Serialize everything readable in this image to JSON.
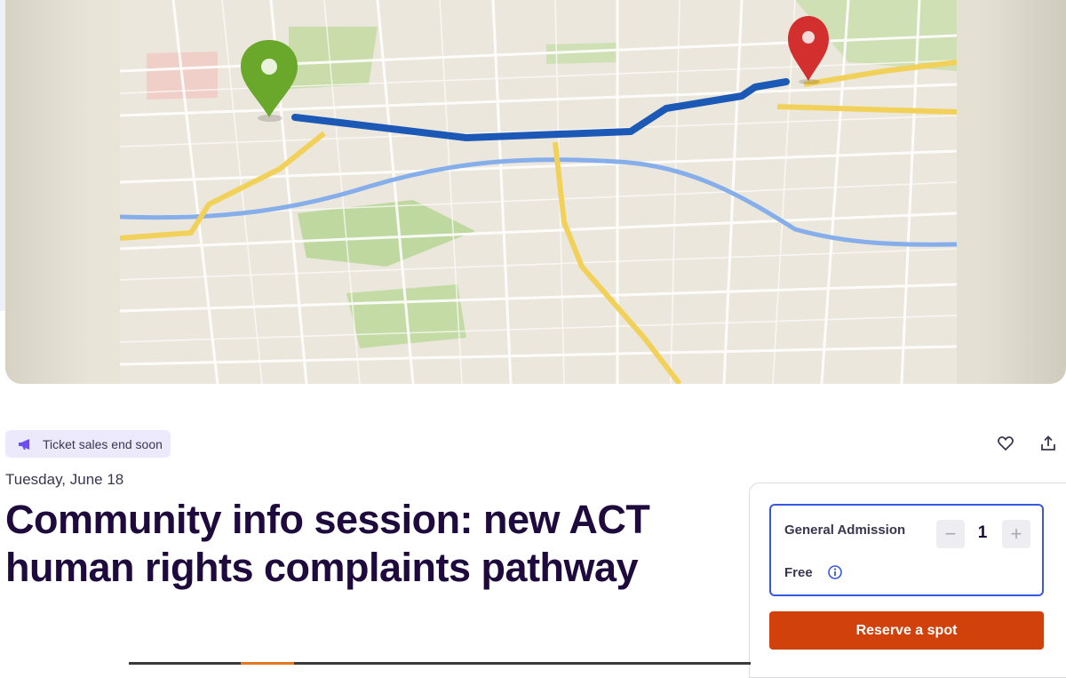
{
  "hero": {
    "alt": "Map with route from green pin to red pin",
    "colors": {
      "route": "#1f5fb8",
      "start_pin": "#6aa82c",
      "end_pin": "#d42f2f",
      "river": "#7da6e6",
      "road": "#f1d35c"
    }
  },
  "badge": {
    "label": "Ticket sales end soon",
    "icon": "megaphone-icon"
  },
  "actions": {
    "like_icon": "heart-icon",
    "share_icon": "share-icon"
  },
  "event": {
    "date": "Tuesday, June 18",
    "title": "Community info session: new ACT human rights complaints pathway"
  },
  "ticket": {
    "name": "General Admission",
    "price": "Free",
    "quantity": "1",
    "decrement_label": "−",
    "increment_label": "+"
  },
  "reserve": {
    "label": "Reserve a spot",
    "color": "#d1410c"
  },
  "colors": {
    "accent": "#3659e3",
    "title": "#1e0a3c",
    "badge_bg": "#ece9fc"
  }
}
